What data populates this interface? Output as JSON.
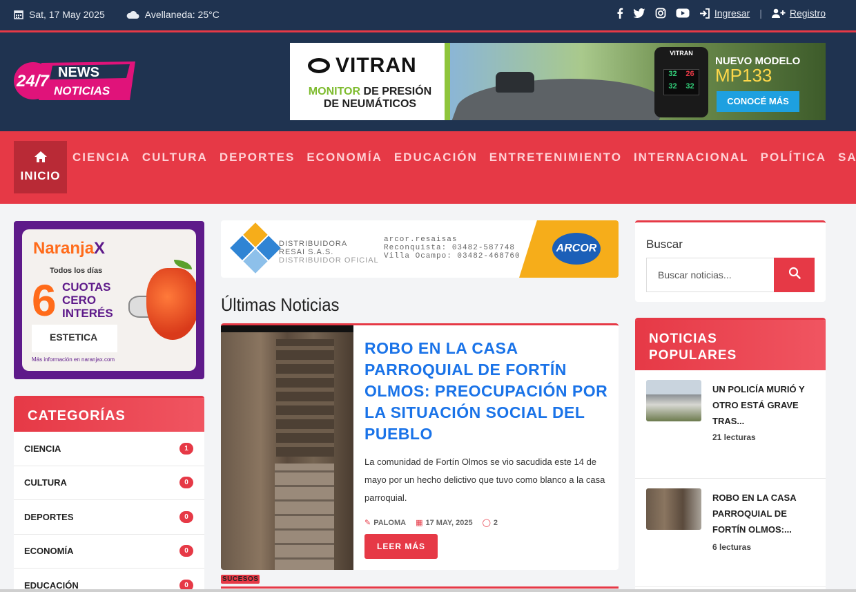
{
  "topbar": {
    "date": "Sat, 17 May 2025",
    "weather": "Avellaneda: 25°C",
    "login": "Ingresar",
    "register": "Registro",
    "social": [
      "facebook-icon",
      "twitter-icon",
      "instagram-icon",
      "youtube-icon"
    ]
  },
  "logo": {
    "line1": "24/7",
    "line2": "NEWS",
    "line3": "NOTICIAS"
  },
  "header_ad": {
    "brand": "VITRAN",
    "tagline_1": "MONITOR",
    "tagline_2": "DE PRESIÓN",
    "tagline_3": "DE NEUMÁTICOS",
    "model_label": "NUEVO MODELO",
    "model": "MP133",
    "cta": "CONOCÉ MÁS"
  },
  "nav": {
    "home": "INICIO",
    "items": [
      "CIENCIA",
      "CULTURA",
      "DEPORTES",
      "ECONOMÍA",
      "EDUCACIÓN",
      "ENTRETENIMIENTO",
      "INTERNACIONAL",
      "POLÍTICA",
      "SALUD"
    ]
  },
  "left_ad": {
    "brand_a": "Naranja",
    "brand_b": "X",
    "todos": "Todos los días",
    "six": "6",
    "cuotas": "CUOTAS",
    "cero": "CERO",
    "interes": "INTERÉS",
    "partner": "ESTETICA",
    "info": "Más información en naranjax.com"
  },
  "categories": {
    "title": "CATEGORÍAS",
    "items": [
      {
        "name": "CIENCIA",
        "count": "1"
      },
      {
        "name": "CULTURA",
        "count": "0"
      },
      {
        "name": "DEPORTES",
        "count": "0"
      },
      {
        "name": "ECONOMÍA",
        "count": "0"
      },
      {
        "name": "EDUCACIÓN",
        "count": "0"
      }
    ]
  },
  "center_ad": {
    "dist_1": "DISTRIBUIDORA",
    "dist_2": "RESAI S.A.S.",
    "dist_3": "DISTRIBUIDOR OFICIAL",
    "social": "arcor.resaisas",
    "phone_1": "Reconquista: 03482-587748",
    "phone_2": "Villa Ocampo: 03482-468760",
    "brand": "ARCOR"
  },
  "main": {
    "section_title": "Últimas Noticias",
    "article": {
      "title": "ROBO EN LA CASA PARROQUIAL DE FORTÍN OLMOS: PREOCUPACIÓN POR LA SITUACIÓN SOCIAL DEL PUEBLO",
      "excerpt": "La comunidad de Fortín Olmos se vio sacudida este 14 de mayo por un hecho delictivo que tuvo como blanco a la casa parroquial.",
      "author": "PALOMA",
      "date": "17 MAY, 2025",
      "comments": "2",
      "cta": "LEER MÁS"
    },
    "next_tag": "SUCESOS"
  },
  "search": {
    "label": "Buscar",
    "placeholder": "Buscar noticias..."
  },
  "popular": {
    "title_1": "NOTICIAS",
    "title_2": "POPULARES",
    "items": [
      {
        "title": "UN POLICÍA MURIÓ Y OTRO ESTÁ GRAVE TRAS...",
        "reads": "21 lecturas"
      },
      {
        "title": "ROBO EN LA CASA PARROQUIAL DE FORTÍN OLMOS:...",
        "reads": "6 lecturas"
      }
    ]
  },
  "colors": {
    "navy": "#1f3350",
    "accent": "#e63946",
    "link": "#1a73e8"
  }
}
